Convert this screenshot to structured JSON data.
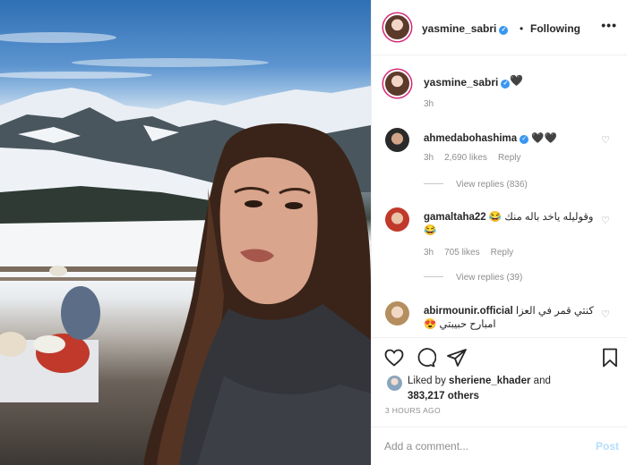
{
  "header": {
    "username": "yasmine_sabri",
    "verified_mark": "✓",
    "bullet": "•",
    "follow_status": "Following",
    "more_icon": "•••"
  },
  "caption": {
    "username": "yasmine_sabri",
    "verified_mark": "✓",
    "text": "🖤",
    "time": "3h"
  },
  "comments": [
    {
      "username": "ahmedabohashima",
      "verified_mark": "✓",
      "text": "🖤🖤",
      "time": "3h",
      "likes": "2,690 likes",
      "reply": "Reply",
      "view_replies": "View replies (836)",
      "avatar_color": "#2a2a2a"
    },
    {
      "username": "gamaltaha22",
      "text": "وقوليله ياخد باله منك 😂",
      "text_line2": "😂",
      "time": "3h",
      "likes": "705 likes",
      "reply": "Reply",
      "view_replies": "View replies (39)",
      "avatar_color": "#c0392b"
    },
    {
      "username": "abirmounir.official",
      "text": "كنتي قمر في العزا",
      "text_line2": "امبارح حبيبتي 😍",
      "avatar_color": "#d9c6a8"
    }
  ],
  "actions": {
    "like_icon": "heart-outline-icon",
    "comment_icon": "comment-icon",
    "share_icon": "paper-plane-icon",
    "save_icon": "bookmark-icon"
  },
  "likes": {
    "prefix": "Liked by",
    "user": "sheriene_khader",
    "and": "and",
    "count": "383,217 others"
  },
  "timestamp": "3 HOURS AGO",
  "comment_box": {
    "placeholder": "Add a comment...",
    "post_label": "Post"
  },
  "colors": {
    "verified": "#3897f0",
    "post_disabled": "#b2dffc",
    "story_ring": "#d62976"
  }
}
